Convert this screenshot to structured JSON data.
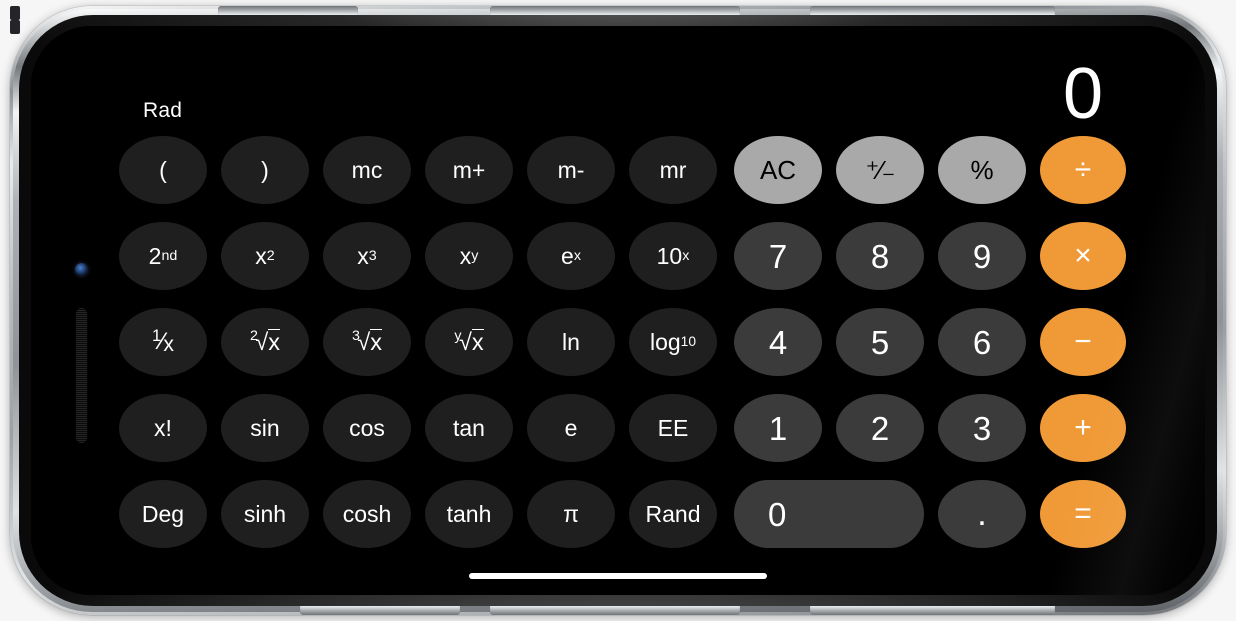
{
  "app": {
    "name": "Calculator",
    "mode": "scientific",
    "orientation": "landscape"
  },
  "display": {
    "value": "0",
    "angle_mode_indicator": "Rad"
  },
  "colors": {
    "accent_orange": "#f09a37",
    "top_key_gray": "#a9a9a9",
    "number_key_gray": "#3b3b3c",
    "function_key_gray": "#1f1f20",
    "screen_background": "#000000",
    "text_light": "#ffffff",
    "text_dark": "#000000"
  },
  "keypad": {
    "rows": [
      {
        "keys": [
          {
            "label": "(",
            "name": "key-open-paren",
            "style": "fn"
          },
          {
            "label": ")",
            "name": "key-close-paren",
            "style": "fn"
          },
          {
            "label": "mc",
            "name": "key-memory-clear",
            "style": "fn"
          },
          {
            "label": "m+",
            "name": "key-memory-add",
            "style": "fn"
          },
          {
            "label": "m-",
            "name": "key-memory-sub",
            "style": "fn"
          },
          {
            "label": "mr",
            "name": "key-memory-recall",
            "style": "fn"
          },
          {
            "label": "AC",
            "name": "key-all-clear",
            "style": "top"
          },
          {
            "label": "+/-",
            "name": "key-plus-minus",
            "style": "top"
          },
          {
            "label": "%",
            "name": "key-percent",
            "style": "top"
          },
          {
            "label": "÷",
            "name": "key-divide",
            "style": "op"
          }
        ]
      },
      {
        "keys": [
          {
            "label": "2nd",
            "name": "key-second",
            "style": "fn",
            "base": "2",
            "sup": "nd"
          },
          {
            "label": "x2",
            "name": "key-x-squared",
            "style": "fn",
            "base": "x",
            "sup": "2"
          },
          {
            "label": "x3",
            "name": "key-x-cubed",
            "style": "fn",
            "base": "x",
            "sup": "3"
          },
          {
            "label": "xy",
            "name": "key-x-power-y",
            "style": "fn",
            "base": "x",
            "sup": "y"
          },
          {
            "label": "ex",
            "name": "key-e-power-x",
            "style": "fn",
            "base": "e",
            "sup": "x"
          },
          {
            "label": "10x",
            "name": "key-ten-power-x",
            "style": "fn",
            "base": "10",
            "sup": "x"
          },
          {
            "label": "7",
            "name": "key-7",
            "style": "num"
          },
          {
            "label": "8",
            "name": "key-8",
            "style": "num"
          },
          {
            "label": "9",
            "name": "key-9",
            "style": "num"
          },
          {
            "label": "×",
            "name": "key-multiply",
            "style": "op"
          }
        ]
      },
      {
        "keys": [
          {
            "label": "1/x",
            "name": "key-reciprocal",
            "style": "fn",
            "kind": "frac",
            "num": "1",
            "den": "x"
          },
          {
            "label": "2√x",
            "name": "key-square-root",
            "style": "fn",
            "kind": "root",
            "index": "2",
            "radicand": "x"
          },
          {
            "label": "3√x",
            "name": "key-cube-root",
            "style": "fn",
            "kind": "root",
            "index": "3",
            "radicand": "x"
          },
          {
            "label": "y√x",
            "name": "key-nth-root",
            "style": "fn",
            "kind": "root",
            "index": "y",
            "radicand": "x"
          },
          {
            "label": "ln",
            "name": "key-natural-log",
            "style": "fn"
          },
          {
            "label": "log10",
            "name": "key-log-base-10",
            "style": "fn",
            "base": "log",
            "sub": "10"
          },
          {
            "label": "4",
            "name": "key-4",
            "style": "num"
          },
          {
            "label": "5",
            "name": "key-5",
            "style": "num"
          },
          {
            "label": "6",
            "name": "key-6",
            "style": "num"
          },
          {
            "label": "−",
            "name": "key-subtract",
            "style": "op"
          }
        ]
      },
      {
        "keys": [
          {
            "label": "x!",
            "name": "key-factorial",
            "style": "fn"
          },
          {
            "label": "sin",
            "name": "key-sine",
            "style": "fn"
          },
          {
            "label": "cos",
            "name": "key-cosine",
            "style": "fn"
          },
          {
            "label": "tan",
            "name": "key-tangent",
            "style": "fn"
          },
          {
            "label": "e",
            "name": "key-euler-number",
            "style": "fn"
          },
          {
            "label": "EE",
            "name": "key-exponent-entry",
            "style": "fn"
          },
          {
            "label": "1",
            "name": "key-1",
            "style": "num"
          },
          {
            "label": "2",
            "name": "key-2",
            "style": "num"
          },
          {
            "label": "3",
            "name": "key-3",
            "style": "num"
          },
          {
            "label": "+",
            "name": "key-add",
            "style": "op"
          }
        ]
      },
      {
        "keys": [
          {
            "label": "Deg",
            "name": "key-degrees-toggle",
            "style": "fn"
          },
          {
            "label": "sinh",
            "name": "key-hyperbolic-sine",
            "style": "fn"
          },
          {
            "label": "cosh",
            "name": "key-hyperbolic-cosine",
            "style": "fn"
          },
          {
            "label": "tanh",
            "name": "key-hyperbolic-tangent",
            "style": "fn"
          },
          {
            "label": "π",
            "name": "key-pi",
            "style": "fn"
          },
          {
            "label": "Rand",
            "name": "key-random",
            "style": "fn"
          },
          {
            "label": "0",
            "name": "key-0",
            "style": "zero"
          },
          {
            "label": ".",
            "name": "key-decimal-point",
            "style": "num"
          },
          {
            "label": "=",
            "name": "key-equals",
            "style": "eq"
          }
        ]
      }
    ]
  },
  "hardware": {
    "notch_label": "notch",
    "camera_label": "front-camera",
    "speaker_label": "earpiece-speaker",
    "home_indicator_label": "home-indicator",
    "buttons": [
      "mute-switch",
      "volume-up",
      "volume-down",
      "power-button"
    ]
  }
}
